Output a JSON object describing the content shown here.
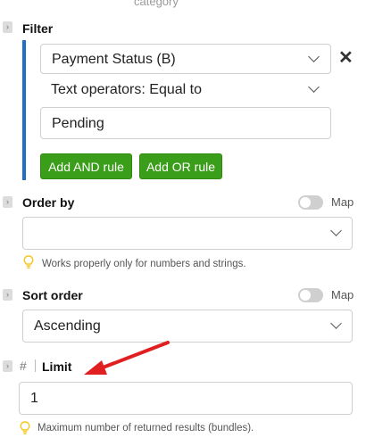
{
  "top_cut_text": "category",
  "filter": {
    "title": "Filter",
    "field_select": "Payment Status (B)",
    "operator_select": "Text operators: Equal to",
    "value_input": "Pending",
    "add_and_label": "Add AND rule",
    "add_or_label": "Add OR rule"
  },
  "order_by": {
    "title": "Order by",
    "map_label": "Map",
    "map_enabled": false,
    "selected_value": "",
    "hint": "Works properly only for numbers and strings."
  },
  "sort_order": {
    "title": "Sort order",
    "map_label": "Map",
    "map_enabled": false,
    "selected_value": "Ascending"
  },
  "limit": {
    "type_symbol": "#",
    "title": "Limit",
    "value": "1",
    "hint": "Maximum number of returned results (bundles)."
  },
  "icons": {
    "expander": "chevron-right-icon",
    "close": "close-icon",
    "dropdown": "chevron-down-icon",
    "hint": "lightbulb-icon",
    "annotation": "red-arrow"
  },
  "colors": {
    "accent_blue": "#1f6fc6",
    "button_green": "#3b9e1a",
    "arrow_red": "#e02020",
    "bulb_yellow": "#f5c518"
  }
}
